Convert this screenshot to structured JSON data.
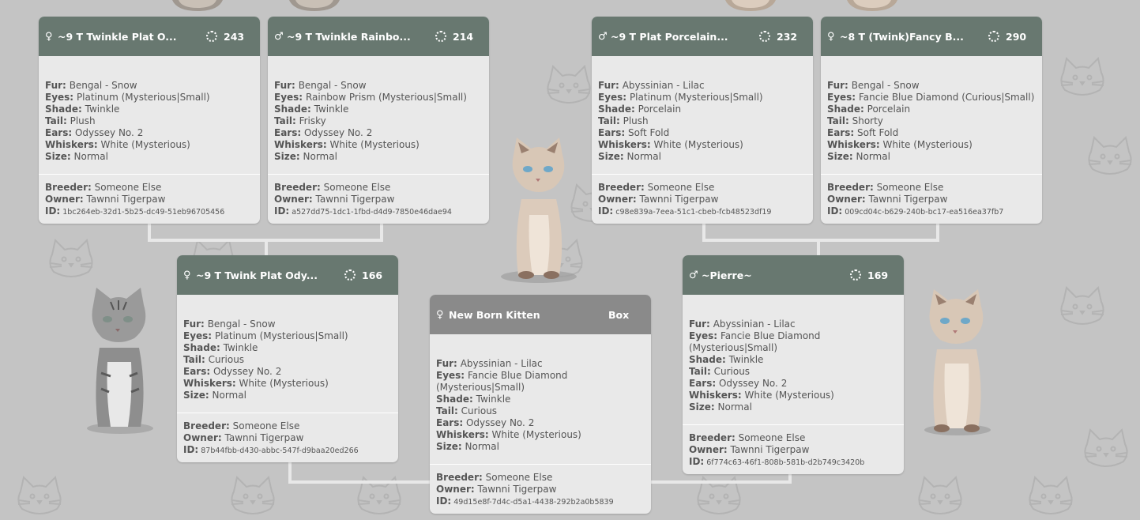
{
  "tree": {
    "cards": [
      {
        "sex": "♀",
        "name": "~9 T Twinkle Plat O...",
        "score": "243",
        "fur": "Bengal - Snow",
        "eyes": "Platinum (Mysterious|Small)",
        "shade": "Twinkle",
        "tail": "Plush",
        "ears": "Odyssey No. 2",
        "whiskers": "White (Mysterious)",
        "size": "Normal",
        "breeder": "Someone Else",
        "owner": "Tawnni Tigerpaw",
        "id": "1bc264eb-32d1-5b25-dc49-51eb96705456"
      },
      {
        "sex": "♂",
        "name": "~9 T Twinkle Rainbo...",
        "score": "214",
        "fur": "Bengal - Snow",
        "eyes": "Rainbow Prism (Mysterious|Small)",
        "shade": "Twinkle",
        "tail": "Frisky",
        "ears": "Odyssey No. 2",
        "whiskers": "White (Mysterious)",
        "size": "Normal",
        "breeder": "Someone Else",
        "owner": "Tawnni Tigerpaw",
        "id": "a527dd75-1dc1-1fbd-d4d9-7850e46dae94"
      },
      {
        "sex": "♂",
        "name": "~9 T Plat Porcelain...",
        "score": "232",
        "fur": "Abyssinian - Lilac",
        "eyes": "Platinum (Mysterious|Small)",
        "shade": "Porcelain",
        "tail": "Plush",
        "ears": "Soft Fold",
        "whiskers": "White (Mysterious)",
        "size": "Normal",
        "breeder": "Someone Else",
        "owner": "Tawnni Tigerpaw",
        "id": "c98e839a-7eea-51c1-cbeb-fcb48523df19"
      },
      {
        "sex": "♀",
        "name": "~8 T (Twink)Fancy B...",
        "score": "290",
        "fur": "Bengal - Snow",
        "eyes": "Fancie Blue Diamond (Curious|Small)",
        "shade": "Porcelain",
        "tail": "Shorty",
        "ears": "Soft Fold",
        "whiskers": "White (Mysterious)",
        "size": "Normal",
        "breeder": "Someone Else",
        "owner": "Tawnni Tigerpaw",
        "id": "009cd04c-b629-240b-bc17-ea516ea37fb7"
      },
      {
        "sex": "♀",
        "name": "~9 T Twink Plat Ody...",
        "score": "166",
        "fur": "Bengal - Snow",
        "eyes": "Platinum (Mysterious|Small)",
        "shade": "Twinkle",
        "tail": "Curious",
        "ears": "Odyssey No. 2",
        "whiskers": "White (Mysterious)",
        "size": "Normal",
        "breeder": "Someone Else",
        "owner": "Tawnni Tigerpaw",
        "id": "87b44fbb-d430-abbc-547f-d9baa20ed266"
      },
      {
        "sex": "♂",
        "name": "~Pierre~",
        "score": "169",
        "fur": "Abyssinian - Lilac",
        "eyes": "Fancie Blue Diamond (Mysterious|Small)",
        "shade": "Twinkle",
        "tail": "Curious",
        "ears": "Odyssey No. 2",
        "whiskers": "White (Mysterious)",
        "size": "Normal",
        "breeder": "Someone Else",
        "owner": "Tawnni Tigerpaw",
        "id": "6f774c63-46f1-808b-581b-d2b749c3420b"
      },
      {
        "sex": "♀",
        "name": "New Born Kitten",
        "score": "Box",
        "fur": "Abyssinian - Lilac",
        "eyes": "Fancie Blue Diamond (Mysterious|Small)",
        "shade": "Twinkle",
        "tail": "Curious",
        "ears": "Odyssey No. 2",
        "whiskers": "White (Mysterious)",
        "size": "Normal",
        "breeder": "Someone Else",
        "owner": "Tawnni Tigerpaw",
        "id": "49d15e8f-7d4c-d5a1-4438-292b2a0b5839"
      }
    ]
  },
  "labels": {
    "fur": "Fur:",
    "eyes": "Eyes:",
    "shade": "Shade:",
    "tail": "Tail:",
    "ears": "Ears:",
    "whiskers": "Whiskers:",
    "size": "Size:",
    "breeder": "Breeder:",
    "owner": "Owner:",
    "id": "ID:"
  },
  "colors": {
    "header": "#687870",
    "kitten_header": "#8a8a8a",
    "card_bg": "#e9e9e9",
    "background": "#c4c4c4"
  }
}
